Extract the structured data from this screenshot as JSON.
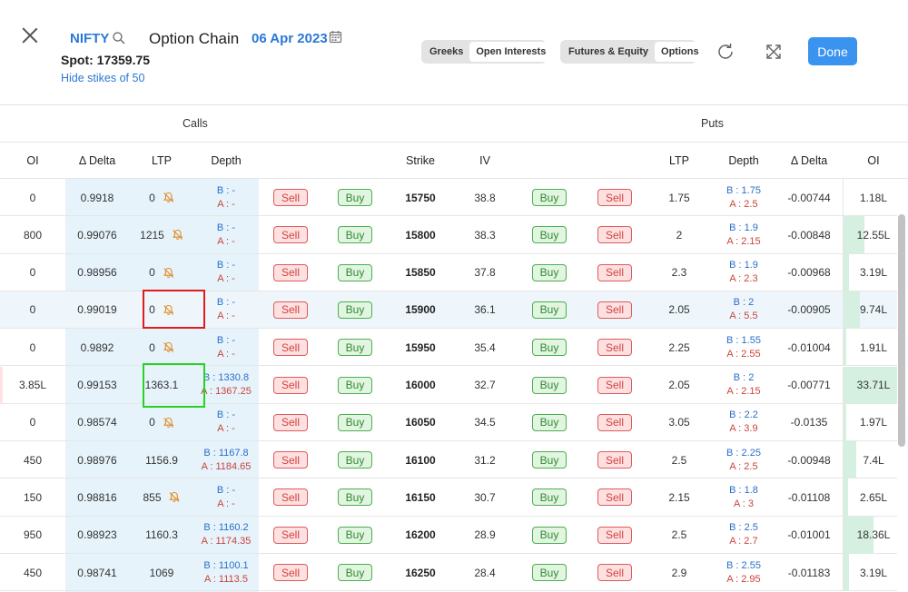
{
  "header": {
    "symbol": "NIFTY",
    "title": "Option Chain",
    "expiry": "06 Apr 2023",
    "spot": "Spot: 17359.75",
    "hide_strikes": "Hide stikes of 50",
    "view_toggle": {
      "options": [
        "Greeks",
        "Open Interests"
      ],
      "active": "Open Interests"
    },
    "segment_toggle": {
      "options": [
        "Futures & Equity",
        "Options"
      ],
      "active": "Options"
    },
    "done_label": "Done"
  },
  "groups": {
    "calls": "Calls",
    "puts": "Puts"
  },
  "columns": {
    "call_oi": "OI",
    "call_delta": "Δ Delta",
    "call_ltp": "LTP",
    "call_depth": "Depth",
    "strike": "Strike",
    "iv": "IV",
    "put_ltp": "LTP",
    "put_depth": "Depth",
    "put_delta": "Δ Delta",
    "put_oi": "OI"
  },
  "labels": {
    "sell": "Sell",
    "buy": "Buy"
  },
  "colors": {
    "accent": "#2a78d6",
    "sell": "#d64040",
    "buy": "#2f8a34",
    "itm_band": "#e6f3fb"
  },
  "rows": [
    {
      "call_oi": "0",
      "call_delta": "0.9918",
      "call_ltp": "0",
      "call_alert": true,
      "call_bid": "B : -",
      "call_ask": "A : -",
      "strike": "15750",
      "iv": "38.8",
      "put_ltp": "1.75",
      "put_bid": "B : 1.75",
      "put_ask": "A : 2.5",
      "put_delta": "-0.00744",
      "put_oi": "1.18L",
      "put_oi_frac": 0.0,
      "call_oi_frac": 0.0
    },
    {
      "call_oi": "800",
      "call_delta": "0.99076",
      "call_ltp": "1215",
      "call_alert": true,
      "call_bid": "B : -",
      "call_ask": "A : -",
      "strike": "15800",
      "iv": "38.3",
      "put_ltp": "2",
      "put_bid": "B : 1.9",
      "put_ask": "A : 2.15",
      "put_delta": "-0.00848",
      "put_oi": "12.55L",
      "put_oi_frac": 0.15,
      "call_oi_frac": 0.0
    },
    {
      "call_oi": "0",
      "call_delta": "0.98956",
      "call_ltp": "0",
      "call_alert": true,
      "call_bid": "B : -",
      "call_ask": "A : -",
      "strike": "15850",
      "iv": "37.8",
      "put_ltp": "2.3",
      "put_bid": "B : 1.9",
      "put_ask": "A : 2.3",
      "put_delta": "-0.00968",
      "put_oi": "3.19L",
      "put_oi_frac": 0.04,
      "call_oi_frac": 0.0
    },
    {
      "call_oi": "0",
      "call_delta": "0.99019",
      "call_ltp": "0",
      "call_alert": true,
      "call_bid": "B : -",
      "call_ask": "A : -",
      "strike": "15900",
      "iv": "36.1",
      "put_ltp": "2.05",
      "put_bid": "B : 2",
      "put_ask": "A : 5.5",
      "put_delta": "-0.00905",
      "put_oi": "9.74L",
      "put_oi_frac": 0.12,
      "call_oi_frac": 0.0,
      "highlight": true
    },
    {
      "call_oi": "0",
      "call_delta": "0.9892",
      "call_ltp": "0",
      "call_alert": true,
      "call_bid": "B : -",
      "call_ask": "A : -",
      "strike": "15950",
      "iv": "35.4",
      "put_ltp": "2.25",
      "put_bid": "B : 1.55",
      "put_ask": "A : 2.55",
      "put_delta": "-0.01004",
      "put_oi": "1.91L",
      "put_oi_frac": 0.02,
      "call_oi_frac": 0.0
    },
    {
      "call_oi": "3.85L",
      "call_delta": "0.99153",
      "call_ltp": "1363.1",
      "call_alert": false,
      "call_bid": "B : 1330.8",
      "call_ask": "A : 1367.25",
      "strike": "16000",
      "iv": "32.7",
      "put_ltp": "2.05",
      "put_bid": "B : 2",
      "put_ask": "A : 2.15",
      "put_delta": "-0.00771",
      "put_oi": "33.71L",
      "put_oi_frac": 0.4,
      "call_oi_frac": 0.05
    },
    {
      "call_oi": "0",
      "call_delta": "0.98574",
      "call_ltp": "0",
      "call_alert": true,
      "call_bid": "B : -",
      "call_ask": "A : -",
      "strike": "16050",
      "iv": "34.5",
      "put_ltp": "3.05",
      "put_bid": "B : 2.2",
      "put_ask": "A : 3.9",
      "put_delta": "-0.0135",
      "put_oi": "1.97L",
      "put_oi_frac": 0.02,
      "call_oi_frac": 0.0
    },
    {
      "call_oi": "450",
      "call_delta": "0.98976",
      "call_ltp": "1156.9",
      "call_alert": false,
      "call_bid": "B : 1167.8",
      "call_ask": "A : 1184.65",
      "strike": "16100",
      "iv": "31.2",
      "put_ltp": "2.5",
      "put_bid": "B : 2.25",
      "put_ask": "A : 2.5",
      "put_delta": "-0.00948",
      "put_oi": "7.4L",
      "put_oi_frac": 0.09,
      "call_oi_frac": 0.0
    },
    {
      "call_oi": "150",
      "call_delta": "0.98816",
      "call_ltp": "855",
      "call_alert": true,
      "call_bid": "B : -",
      "call_ask": "A : -",
      "strike": "16150",
      "iv": "30.7",
      "put_ltp": "2.15",
      "put_bid": "B : 1.8",
      "put_ask": "A : 3",
      "put_delta": "-0.01108",
      "put_oi": "2.65L",
      "put_oi_frac": 0.03,
      "call_oi_frac": 0.0
    },
    {
      "call_oi": "950",
      "call_delta": "0.98923",
      "call_ltp": "1160.3",
      "call_alert": false,
      "call_bid": "B : 1160.2",
      "call_ask": "A : 1174.35",
      "strike": "16200",
      "iv": "28.9",
      "put_ltp": "2.5",
      "put_bid": "B : 2.5",
      "put_ask": "A : 2.7",
      "put_delta": "-0.01001",
      "put_oi": "18.36L",
      "put_oi_frac": 0.22,
      "call_oi_frac": 0.0
    },
    {
      "call_oi": "450",
      "call_delta": "0.98741",
      "call_ltp": "1069",
      "call_alert": false,
      "call_bid": "B : 1100.1",
      "call_ask": "A : 1113.5",
      "strike": "16250",
      "iv": "28.4",
      "put_ltp": "2.9",
      "put_bid": "B : 2.55",
      "put_ask": "A : 2.95",
      "put_delta": "-0.01183",
      "put_oi": "3.19L",
      "put_oi_frac": 0.04,
      "call_oi_frac": 0.0
    }
  ]
}
